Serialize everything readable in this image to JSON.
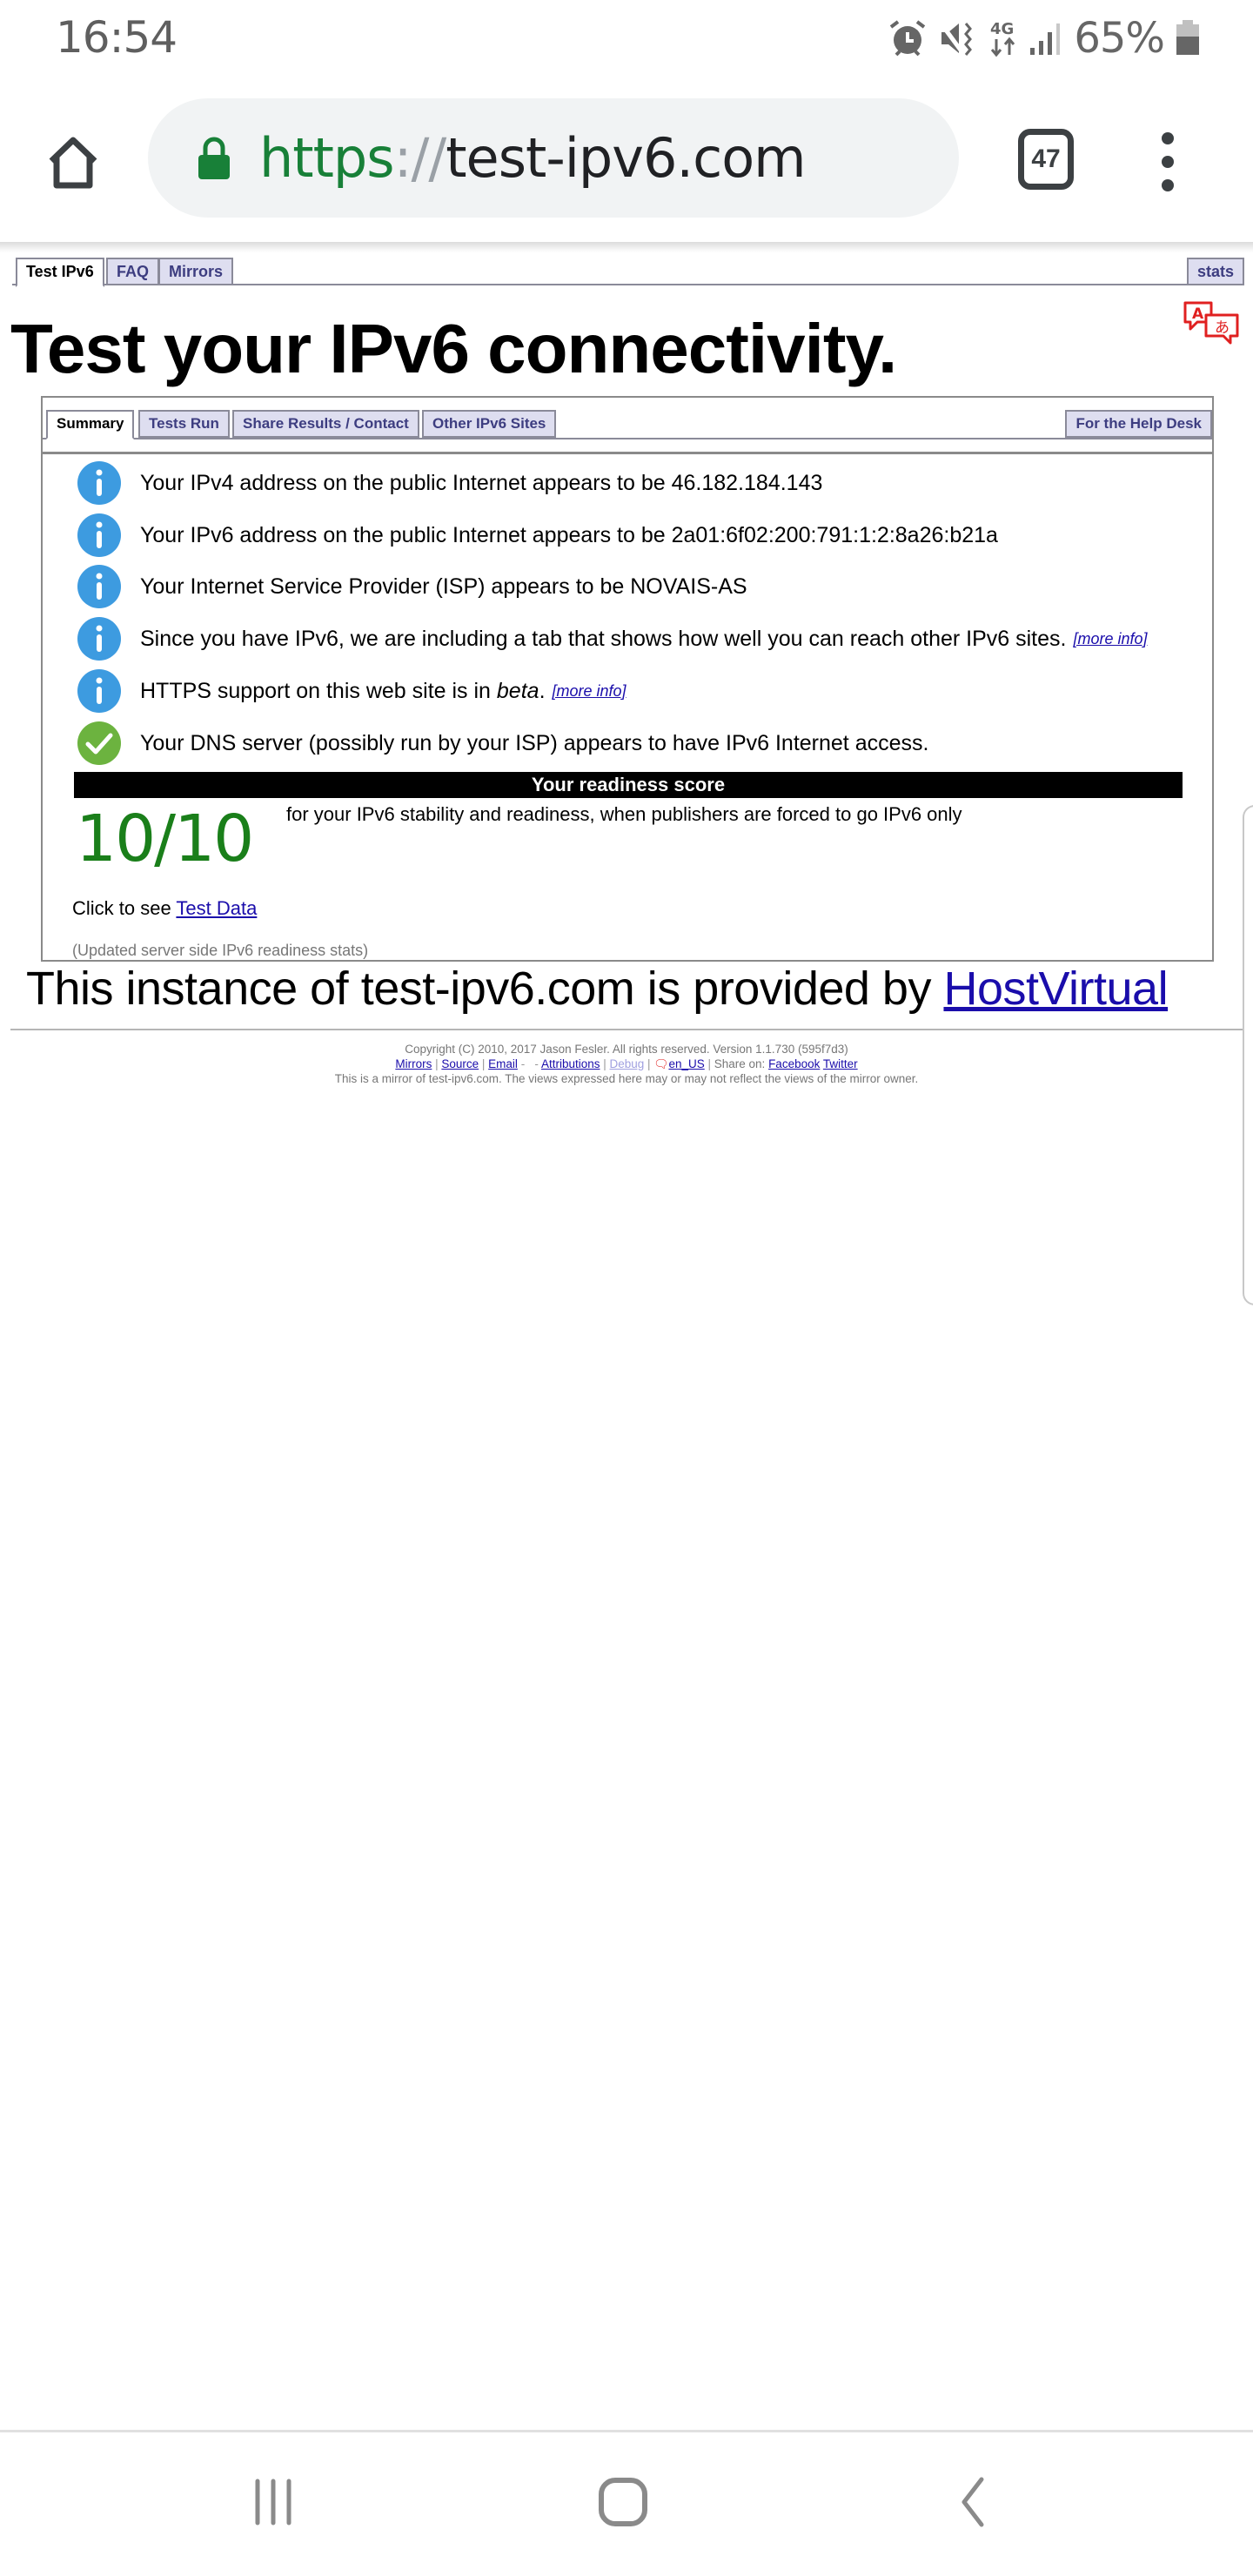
{
  "status_bar": {
    "time": "16:54",
    "network": "4G",
    "battery_percent": "65%",
    "icons": [
      "alarm-icon",
      "mute-icon",
      "4g-data-icon",
      "signal-icon",
      "battery-icon"
    ]
  },
  "browser": {
    "url_scheme": "https",
    "url_separator": "://",
    "url_host": "test-ipv6.com",
    "tab_count": "47",
    "icons": [
      "home-icon",
      "lock-icon",
      "tab-switcher-icon",
      "more-vert-icon"
    ]
  },
  "top_tabs": [
    {
      "label": "Test IPv6",
      "active": true
    },
    {
      "label": "FAQ",
      "active": false
    },
    {
      "label": "Mirrors",
      "active": false
    }
  ],
  "top_tab_right": {
    "label": "stats"
  },
  "page_title": "Test your IPv6 connectivity.",
  "sub_tabs": [
    {
      "label": "Summary",
      "active": true
    },
    {
      "label": "Tests Run",
      "active": false
    },
    {
      "label": "Share Results / Contact",
      "active": false
    },
    {
      "label": "Other IPv6 Sites",
      "active": false
    }
  ],
  "sub_tab_right": {
    "label": "For the Help Desk"
  },
  "results": [
    {
      "icon": "info",
      "text": "Your IPv4 address on the public Internet appears to be 46.182.184.143"
    },
    {
      "icon": "info",
      "text": "Your IPv6 address on the public Internet appears to be 2a01:6f02:200:791:1:2:8a26:b21a"
    },
    {
      "icon": "info",
      "text": "Your Internet Service Provider (ISP) appears to be NOVAIS-AS"
    },
    {
      "icon": "info",
      "text": "Since you have IPv6, we are including a tab that shows how well you can reach other IPv6 sites.",
      "link": "[more info]"
    },
    {
      "icon": "info",
      "text_pre": "HTTPS support on this web site is in ",
      "text_em": "beta",
      "text_post": ".",
      "link": "[more info]"
    },
    {
      "icon": "ok",
      "text": "Your DNS server (possibly run by your ISP) appears to have IPv6 Internet access."
    }
  ],
  "score": {
    "header": "Your readiness score",
    "value": "10/10",
    "description": "for your IPv6 stability and readiness, when publishers are forced to go IPv6 only",
    "color": "#1a7f1a"
  },
  "test_data": {
    "prefix": "Click to see ",
    "link": "Test Data"
  },
  "updated_stats": "(Updated server side IPv6 readiness stats)",
  "provided_by": {
    "text": "This instance of test-ipv6.com is provided by ",
    "link": "HostVirtual"
  },
  "footer": {
    "copyright": "Copyright (C) 2010, 2017 Jason Fesler. All rights reserved. Version 1.1.730 (595f7d3)",
    "links": {
      "mirrors": "Mirrors",
      "source": "Source",
      "email": "Email",
      "attributions": "Attributions",
      "debug": "Debug",
      "locale": "en_US",
      "share_label": "Share on:",
      "facebook": "Facebook",
      "twitter": "Twitter"
    },
    "disclaimer": "This is a mirror of test-ipv6.com. The views expressed here may or may not reflect the views of the mirror owner."
  },
  "colors": {
    "info_blue": "#3d9be0",
    "ok_green": "#6cb33f",
    "tab_bg": "#dedef0",
    "tab_text": "#3d3d80",
    "link": "#1a0dab",
    "secure_green": "#188038"
  },
  "nav_bar": {
    "icons": [
      "recent-apps-icon",
      "home-nav-icon",
      "back-icon"
    ]
  }
}
